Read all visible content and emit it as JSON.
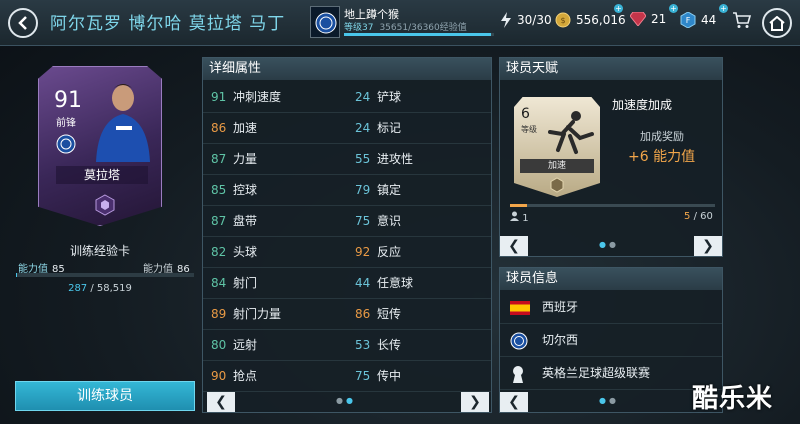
{
  "header": {
    "title": "阿尔瓦罗 博尔哈 莫拉塔 马丁",
    "team_name": "地上蹲个猴",
    "level_label": "等级37",
    "xp_text": "35651/36360经验值",
    "xp_fraction": 0.98,
    "energy": "30/30",
    "coins": "556,016",
    "gems": "21",
    "fifa_points": "44"
  },
  "card": {
    "rating": "91",
    "position": "前锋",
    "name": "莫拉塔"
  },
  "training": {
    "label": "训练经验卡",
    "ovr_label": "能力值",
    "ovr_current": "85",
    "ovr_target": "86",
    "xp_current": "287",
    "xp_total": "/ 58,519",
    "xp_fraction": 0.005,
    "button_label": "训练球员"
  },
  "attributes": {
    "title": "详细属性",
    "left": [
      {
        "value": "91",
        "name": "冲刺速度",
        "color": "#5fc4a6"
      },
      {
        "value": "86",
        "name": "加速",
        "color": "#e99a45"
      },
      {
        "value": "87",
        "name": "力量",
        "color": "#5fc4a6"
      },
      {
        "value": "85",
        "name": "控球",
        "color": "#5fc4a6"
      },
      {
        "value": "87",
        "name": "盘带",
        "color": "#5fc4a6"
      },
      {
        "value": "82",
        "name": "头球",
        "color": "#5fc4a6"
      },
      {
        "value": "84",
        "name": "射门",
        "color": "#5fc4a6"
      },
      {
        "value": "89",
        "name": "射门力量",
        "color": "#e99a45"
      },
      {
        "value": "80",
        "name": "远射",
        "color": "#5fc4a6"
      },
      {
        "value": "90",
        "name": "抢点",
        "color": "#e99a45"
      }
    ],
    "right": [
      {
        "value": "24",
        "name": "铲球",
        "color": "#6bc3d8"
      },
      {
        "value": "24",
        "name": "标记",
        "color": "#6bc3d8"
      },
      {
        "value": "55",
        "name": "进攻性",
        "color": "#6bc3d8"
      },
      {
        "value": "79",
        "name": "镇定",
        "color": "#6bc3d8"
      },
      {
        "value": "75",
        "name": "意识",
        "color": "#6bc3d8"
      },
      {
        "value": "92",
        "name": "反应",
        "color": "#e99a45"
      },
      {
        "value": "44",
        "name": "任意球",
        "color": "#6bc3d8"
      },
      {
        "value": "86",
        "name": "短传",
        "color": "#e99a45"
      },
      {
        "value": "53",
        "name": "长传",
        "color": "#6bc3d8"
      },
      {
        "value": "75",
        "name": "传中",
        "color": "#6bc3d8"
      }
    ]
  },
  "talent": {
    "title": "球员天赋",
    "level": "6",
    "level_label": "等级",
    "card_name": "加速",
    "name": "加速度加成",
    "bonus_label": "加成奖励",
    "bonus_value": "+6 能力值",
    "progress_min": "1",
    "progress_current": "5",
    "progress_total": "/ 60",
    "progress_fraction": 0.083
  },
  "info": {
    "title": "球员信息",
    "nation": "西班牙",
    "club": "切尔西",
    "league": "英格兰足球超级联赛"
  },
  "watermark": "酷乐米"
}
